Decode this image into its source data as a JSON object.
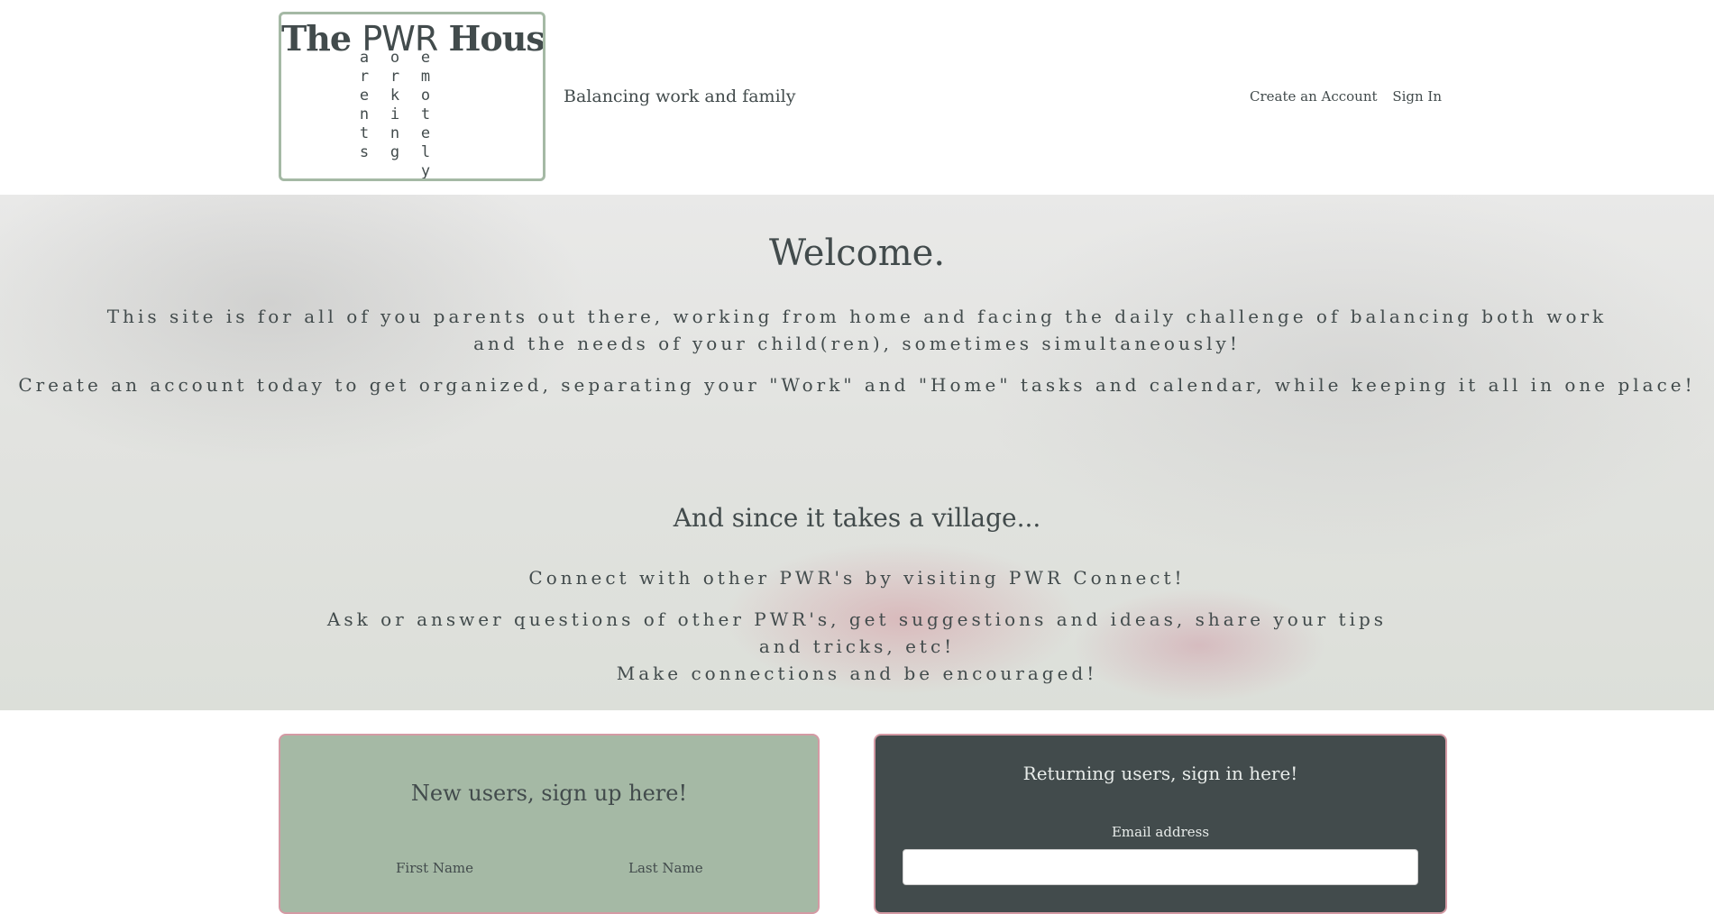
{
  "header": {
    "logo": {
      "word_the": "The",
      "word_pwr": "PWR",
      "word_house": "House",
      "col_p": "arents",
      "col_w": "orking",
      "col_r": "emotely"
    },
    "tagline": "Balancing work and family",
    "nav": {
      "create_account": "Create an Account",
      "sign_in": "Sign In"
    }
  },
  "hero": {
    "welcome": "Welcome.",
    "intro": "This site is for all of you parents out there, working from home and facing the daily challenge of balancing both work and the needs of your child(ren), sometimes simultaneously!",
    "cta": "Create an account today to get organized, separating your \"Work\" and \"Home\" tasks and calendar, while keeping it all in one place!",
    "village_heading": "And since it takes a village...",
    "connect": "Connect with other PWR's by visiting PWR Connect!",
    "ask_line1": "Ask or answer questions of other PWR's, get suggestions and ideas, share your tips and tricks, etc!",
    "ask_line2": "Make connections and be encouraged!"
  },
  "signup": {
    "heading": "New users, sign up here!",
    "first_name_label": "First Name",
    "last_name_label": "Last Name"
  },
  "signin": {
    "heading": "Returning users, sign in here!",
    "email_label": "Email address",
    "email_value": ""
  },
  "colors": {
    "text": "#424b4c",
    "sage": "#a5b9a5",
    "dark": "#424b4c",
    "card_border": "#d49aa4"
  }
}
